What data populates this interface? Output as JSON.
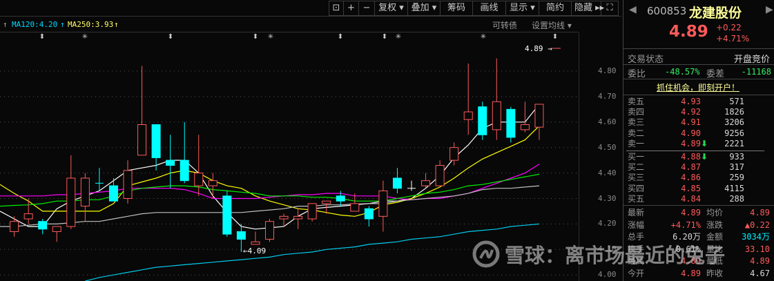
{
  "toolbar": {
    "lock": "⊡",
    "zoom_in": "+",
    "zoom_out": "−",
    "fuquan": "复权 ▾",
    "diejia": "叠加 ▾",
    "chouma": "筹码",
    "huaxian": "画线",
    "xianshi": "显示 ▾",
    "jianyue": "简约",
    "yincang": "隐藏 ▸▸",
    "fullscreen": "⛶"
  },
  "ma_legend": [
    {
      "label": "MA120:4.20",
      "color": "#00d8ff"
    },
    {
      "label": "MA250:3.93",
      "color": "#ffff66"
    }
  ],
  "chart_header": {
    "convertible": "可转债",
    "set_ma": "设置均线 ▾"
  },
  "chart_data": {
    "type": "candlestick",
    "yticks": [
      "4.80",
      "4.70",
      "4.60",
      "4.50",
      "4.40",
      "4.30",
      "4.20",
      "4.10",
      "4.00"
    ],
    "ylim": [
      4.0,
      4.8
    ],
    "candles": [
      [
        4.17,
        4.21,
        4.23,
        4.15
      ],
      [
        4.22,
        4.24,
        4.3,
        4.2
      ],
      [
        4.21,
        4.18,
        4.22,
        4.16
      ],
      [
        4.17,
        4.19,
        4.19,
        4.13
      ],
      [
        4.19,
        4.38,
        4.47,
        4.18
      ],
      [
        4.27,
        4.38,
        4.4,
        4.21
      ],
      [
        4.36,
        4.36,
        4.42,
        4.33
      ],
      [
        4.35,
        4.29,
        4.38,
        4.29
      ],
      [
        4.3,
        4.41,
        4.45,
        4.28
      ],
      [
        4.47,
        4.59,
        4.82,
        4.47
      ],
      [
        4.59,
        4.46,
        4.59,
        4.41
      ],
      [
        4.45,
        4.43,
        4.55,
        4.34
      ],
      [
        4.45,
        4.37,
        4.6,
        4.36
      ],
      [
        4.35,
        4.4,
        4.55,
        4.31
      ],
      [
        4.35,
        4.37,
        4.4,
        4.3
      ],
      [
        4.31,
        4.16,
        4.33,
        4.15
      ],
      [
        4.17,
        4.14,
        4.2,
        4.09
      ],
      [
        4.12,
        4.13,
        4.17,
        4.12
      ],
      [
        4.14,
        4.21,
        4.22,
        4.13
      ],
      [
        4.22,
        4.23,
        4.24,
        4.19
      ],
      [
        4.22,
        4.23,
        4.26,
        4.18
      ],
      [
        4.22,
        4.28,
        4.28,
        4.21
      ],
      [
        4.28,
        4.29,
        4.29,
        4.24
      ],
      [
        4.31,
        4.29,
        4.33,
        4.27
      ],
      [
        4.25,
        4.28,
        4.32,
        4.25
      ],
      [
        4.26,
        4.22,
        4.27,
        4.19
      ],
      [
        4.23,
        4.33,
        4.37,
        4.17
      ],
      [
        4.38,
        4.34,
        4.42,
        4.32
      ],
      [
        4.34,
        4.34,
        4.37,
        4.33
      ],
      [
        4.35,
        4.37,
        4.4,
        4.34
      ],
      [
        4.35,
        4.43,
        4.45,
        4.35
      ],
      [
        4.45,
        4.5,
        4.52,
        4.43
      ],
      [
        4.61,
        4.64,
        4.83,
        4.55
      ],
      [
        4.66,
        4.55,
        4.68,
        4.53
      ],
      [
        4.57,
        4.68,
        4.85,
        4.53
      ],
      [
        4.65,
        4.54,
        4.66,
        4.52
      ],
      [
        4.57,
        4.59,
        4.68,
        4.56
      ],
      [
        4.58,
        4.67,
        4.67,
        4.53
      ]
    ],
    "ma_lines": [
      {
        "color": "#ffffff",
        "values": [
          4.25,
          4.22,
          4.19,
          4.19,
          4.26,
          4.29,
          4.31,
          4.33,
          4.37,
          4.41,
          4.42,
          4.43,
          4.45,
          4.45,
          4.4,
          4.31,
          4.245,
          4.19,
          4.18,
          4.185,
          4.19,
          4.23,
          4.26,
          4.265,
          4.27,
          4.275,
          4.28,
          4.29,
          4.29,
          4.3,
          4.34,
          4.39,
          4.46,
          4.51,
          4.575,
          4.6,
          4.6,
          4.6,
          4.67
        ]
      },
      {
        "color": "#ffff00",
        "values": [
          4.355,
          4.32,
          4.29,
          4.25,
          4.25,
          4.25,
          4.25,
          4.25,
          4.28,
          4.35,
          4.365,
          4.38,
          4.4,
          4.41,
          4.4,
          4.37,
          4.35,
          4.34,
          4.31,
          4.29,
          4.275,
          4.26,
          4.255,
          4.245,
          4.235,
          4.23,
          4.245,
          4.275,
          4.285,
          4.3,
          4.32,
          4.345,
          4.38,
          4.42,
          4.455,
          4.48,
          4.505,
          4.53,
          4.585
        ]
      },
      {
        "color": "#ff00ff",
        "values": [
          4.31,
          4.31,
          4.31,
          4.31,
          4.315,
          4.315,
          4.32,
          4.325,
          4.33,
          4.34,
          4.34,
          4.34,
          4.34,
          4.335,
          4.32,
          4.3,
          4.3,
          4.3,
          4.3,
          4.305,
          4.31,
          4.315,
          4.315,
          4.32,
          4.32,
          4.31,
          4.31,
          4.31,
          4.3,
          4.295,
          4.3,
          4.3,
          4.31,
          4.32,
          4.34,
          4.36,
          4.38,
          4.4,
          4.435
        ]
      },
      {
        "color": "#00ee00",
        "values": [
          4.27,
          4.273,
          4.275,
          4.28,
          4.29,
          4.29,
          4.295,
          4.295,
          4.31,
          4.33,
          4.34,
          4.345,
          4.35,
          4.35,
          4.345,
          4.335,
          4.33,
          4.325,
          4.32,
          4.31,
          4.31,
          4.31,
          4.305,
          4.305,
          4.3,
          4.29,
          4.29,
          4.29,
          4.3,
          4.31,
          4.32,
          4.325,
          4.335,
          4.35,
          4.355,
          4.365,
          4.375,
          4.385,
          4.395
        ]
      },
      {
        "color": "#c0c0c0",
        "values": [
          4.19,
          4.19,
          4.195,
          4.2,
          4.2,
          4.205,
          4.21,
          4.21,
          4.22,
          4.23,
          4.24,
          4.245,
          4.245,
          4.245,
          4.245,
          4.245,
          4.245,
          4.245,
          4.25,
          4.255,
          4.26,
          4.27,
          4.27,
          4.275,
          4.275,
          4.278,
          4.28,
          4.28,
          4.29,
          4.295,
          4.3,
          4.305,
          4.31,
          4.32,
          4.335,
          4.34,
          4.34,
          4.345,
          4.35
        ]
      },
      {
        "color": "#00ccee",
        "values": [
          null,
          null,
          null,
          null,
          null,
          null,
          3.976,
          3.99,
          4.0,
          4.01,
          4.02,
          4.03,
          4.035,
          4.04,
          4.045,
          4.05,
          4.055,
          4.06,
          4.065,
          4.07,
          4.08,
          4.085,
          4.09,
          4.1,
          4.105,
          4.11,
          4.12,
          4.125,
          4.13,
          4.14,
          4.145,
          4.15,
          4.16,
          4.17,
          4.175,
          4.18,
          4.19,
          4.195,
          4.2
        ]
      }
    ],
    "markers": [
      "⬍",
      "✳",
      "⬍",
      "⬍",
      "✳",
      "⬍",
      "⬍",
      "✳",
      "✳",
      "⬍"
    ],
    "last_price_label": "4.89",
    "low_label": "4.09"
  },
  "panel": {
    "code": "600853",
    "name": "龙建股份",
    "price": "4.89",
    "change": "+0.22",
    "change_pct": "+4.71%",
    "status_label": "交易状态",
    "status_value": "开盘竞价",
    "weibi_label": "委比",
    "weibi": "-48.57%",
    "weicha_label": "委差",
    "weicha": "-11168",
    "promo": "抓住机会，即刻开户！",
    "asks": [
      {
        "label": "卖五",
        "price": "4.93",
        "vol": "571"
      },
      {
        "label": "卖四",
        "price": "4.92",
        "vol": "1826"
      },
      {
        "label": "卖三",
        "price": "4.91",
        "vol": "3206"
      },
      {
        "label": "卖二",
        "price": "4.90",
        "vol": "9256"
      },
      {
        "label": "卖一",
        "price": "4.89",
        "vol": "2221",
        "arrow": "⬇"
      }
    ],
    "bids": [
      {
        "label": "买一",
        "price": "4.88",
        "vol": "933",
        "arrow": "⬇"
      },
      {
        "label": "买二",
        "price": "4.87",
        "vol": "317"
      },
      {
        "label": "买三",
        "price": "4.86",
        "vol": "259"
      },
      {
        "label": "买四",
        "price": "4.85",
        "vol": "4115"
      },
      {
        "label": "买五",
        "price": "4.84",
        "vol": "288"
      }
    ],
    "stats": [
      {
        "l1": "最新",
        "v1": "4.89",
        "c1": "#ff5a5a",
        "l2": "均价",
        "v2": "4.89",
        "c2": "#ff5a5a"
      },
      {
        "l1": "涨幅",
        "v1": "+4.71%",
        "c1": "#ff5a5a",
        "l2": "涨跌",
        "v2": "▲0.22",
        "c2": "#ff5a5a"
      },
      {
        "l1": "总手",
        "v1": "6.20万",
        "c1": "#d8d8d8",
        "l2": "金额",
        "v2": "3034万",
        "c2": "#00f0ff"
      },
      {
        "l1": "换手",
        "v1": "0.61%",
        "c1": "#d8d8d8",
        "l2": "量比",
        "v2": "33.10",
        "c2": "#ff5a5a"
      },
      {
        "l1": "最高",
        "v1": "4.89",
        "c1": "#ff5a5a",
        "l2": "最低",
        "v2": "4.89",
        "c2": "#ff5a5a"
      },
      {
        "l1": "今开",
        "v1": "4.89",
        "c1": "#ff5a5a",
        "l2": "昨收",
        "v2": "4.67",
        "c2": "#d8d8d8"
      }
    ]
  },
  "watermark": "雪球：离市场最近的兔子",
  "colors": {
    "up": "#ff5a5a",
    "down": "#00ffff",
    "bg": "#080808"
  }
}
